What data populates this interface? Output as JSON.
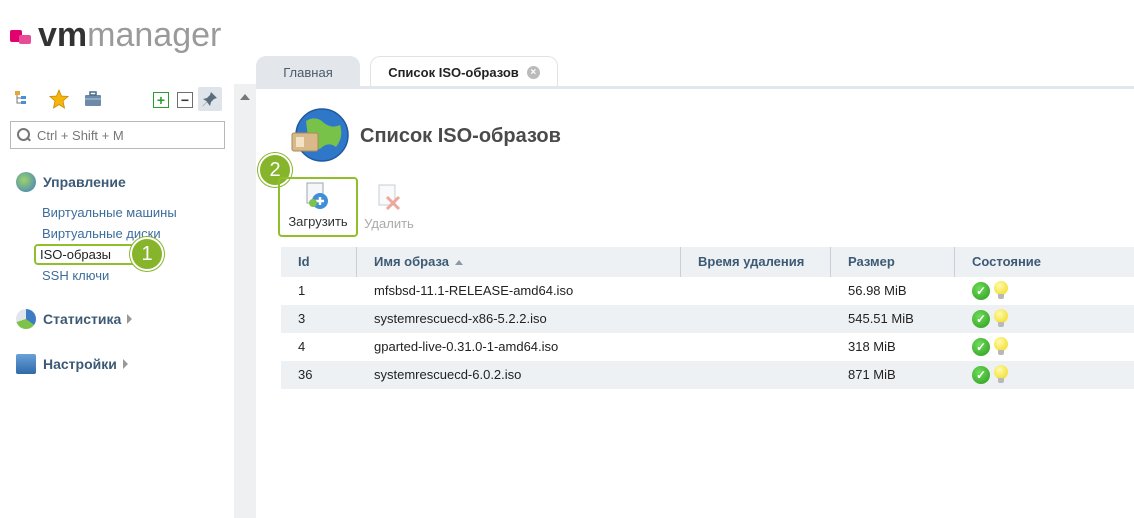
{
  "app": {
    "logo_vm": "vm",
    "logo_manager": "manager"
  },
  "sidebar": {
    "search_placeholder": "Ctrl + Shift + M",
    "groups": [
      {
        "label": "Управление",
        "expanded": true
      },
      {
        "label": "Статистика",
        "expanded": false
      },
      {
        "label": "Настройки",
        "expanded": false
      }
    ],
    "items": [
      "Виртуальные машины",
      "Виртуальные диски",
      "ISO-образы",
      "SSH ключи"
    ],
    "active_item": "ISO-образы"
  },
  "tabs": [
    {
      "label": "Главная",
      "active": false
    },
    {
      "label": "Список ISO-образов",
      "active": true
    }
  ],
  "page": {
    "title": "Список ISO-образов",
    "toolbar": {
      "upload_label": "Загрузить",
      "delete_label": "Удалить"
    }
  },
  "annotations": {
    "step1": "1",
    "step2": "2"
  },
  "table": {
    "columns": [
      "Id",
      "Имя образа",
      "Время удаления",
      "Размер",
      "Состояние"
    ],
    "sorted_column": "Имя образа",
    "rows": [
      {
        "id": "1",
        "name": "mfsbsd-11.1-RELEASE-amd64.iso",
        "deleted": "",
        "size": "56.98 MiB"
      },
      {
        "id": "3",
        "name": "systemrescuecd-x86-5.2.2.iso",
        "deleted": "",
        "size": "545.51 MiB"
      },
      {
        "id": "4",
        "name": "gparted-live-0.31.0-1-amd64.iso",
        "deleted": "",
        "size": "318 MiB"
      },
      {
        "id": "36",
        "name": "systemrescuecd-6.0.2.iso",
        "deleted": "",
        "size": "871 MiB"
      }
    ]
  },
  "colors": {
    "accent_green": "#86b52b",
    "header_text": "#3d5a75",
    "link": "#3d6d9c",
    "brand_pink": "#e3006f"
  }
}
